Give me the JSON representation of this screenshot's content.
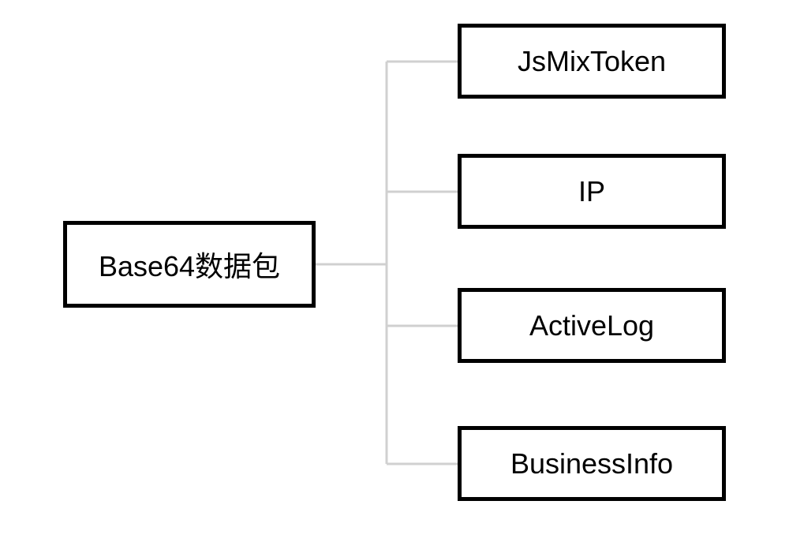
{
  "diagram": {
    "root": {
      "label": "Base64数据包"
    },
    "children": [
      {
        "label": "JsMixToken"
      },
      {
        "label": "IP"
      },
      {
        "label": "ActiveLog"
      },
      {
        "label": "BusinessInfo"
      }
    ]
  }
}
